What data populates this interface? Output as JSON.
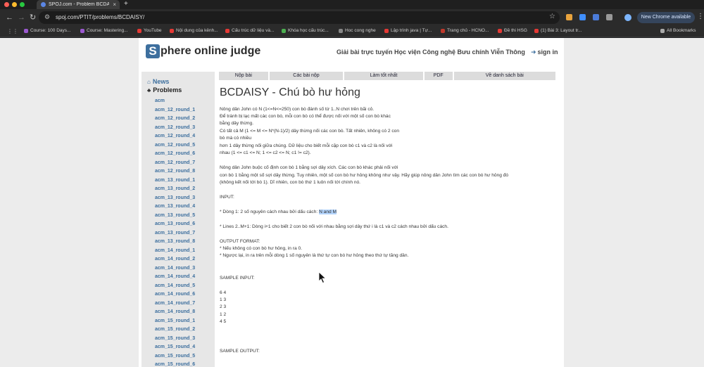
{
  "browser": {
    "tab_title": "SPOJ.com - Problem BCDAISY",
    "url": "spoj.com/PTIT/problems/BCDAISY/",
    "new_chrome_label": "New Chrome available",
    "bookmarks": [
      "Course: 100 Days...",
      "Course: Mastering...",
      "YouTube",
      "Nội dung của kênh...",
      "Cấu trúc dữ liệu và...",
      "Khóa học cấu trúc...",
      "Hoc cong nghe",
      "Lập trình java | Tự...",
      "Trang chủ - HCNO...",
      "Đề thi HSG",
      "(1) Bài 3: Layout tr..."
    ],
    "all_bookmarks": "All Bookmarks"
  },
  "site": {
    "logo_letter": "S",
    "logo_rest": "phere online judge",
    "tagline": "Giải bài trực tuyến Học viện Công nghệ Bưu chính Viễn Thông",
    "signin": "sign in"
  },
  "sidebar": {
    "news": "News",
    "problems": "Problems",
    "links": [
      "acm",
      "acm_12_round_1",
      "acm_12_round_2",
      "acm_12_round_3",
      "acm_12_round_4",
      "acm_12_round_5",
      "acm_12_round_6",
      "acm_12_round_7",
      "acm_12_round_8",
      "acm_13_round_1",
      "acm_13_round_2",
      "acm_13_round_3",
      "acm_13_round_4",
      "acm_13_round_5",
      "acm_13_round_6",
      "acm_13_round_7",
      "acm_13_round_8",
      "acm_14_round_1",
      "acm_14_round_2",
      "acm_14_round_3",
      "acm_14_round_4",
      "acm_14_round_5",
      "acm_14_round_6",
      "acm_14_round_7",
      "acm_14_round_8",
      "acm_15_round_1",
      "acm_15_round_2",
      "acm_15_round_3",
      "acm_15_round_4",
      "acm_15_round_5",
      "acm_15_round_6"
    ]
  },
  "problem_nav": [
    "Nộp bài",
    "Các bài nộp",
    "Làm tốt nhất",
    "PDF",
    "Về danh sách bài"
  ],
  "problem": {
    "title": "BCDAISY - Chú bò hư hỏng",
    "lines": [
      "Nông dân John có N (1<=N<=250) con bò đánh số từ 1..N chơi trên bãi cỏ.",
      "Để tránh bị lạc mất các con bò, mỗi con bò có thể được nối với một số con bò khác",
      "bằng dây thừng.",
      "Có tất cả M (1 <= M <= N*(N-1)/2) dây thừng nối các con bò. Tất nhiên, không có 2 con",
      "bò mà có nhiều",
      "hơn 1 dây thừng nối giữa chúng. Dữ liệu cho biết mỗi cặp con bò c1 và c2 là nối với",
      "nhau (1 <= c1 <= N; 1 <= c2 <= N; c1 != c2).",
      "Nông dân John buộc cố định con bò 1 bằng sợi dây xích. Các con bò khác phải nối với",
      "con bò 1 bằng một số sợi dây thừng. Tuy nhiên, một số con bò hư hỏng không như vậy. Hãy giúp nông dân John tìm các con bò hư hỏng đó",
      "(không kết nối tới bò 1). Dĩ nhiên, con bò thứ 1 luôn nối tới chính nó.",
      "INPUT:",
      "* Dòng 1: 2 số nguyên cách nhau bởi dấu cách: ",
      "* Lines 2..M+1: Dòng i+1 cho biết 2 con bò nối với nhau bằng sợi dây thứ i là c1 và c2 cách nhau bởi dấu cách.",
      "OUTPUT FORMAT:",
      "* Nếu không có con bò hư hỏng, in ra 0.",
      "* Ngược lại, in ra trên mỗi dòng 1 số nguyên là thứ tự con bò hư hỏng theo thứ tự tăng dần.",
      "SAMPLE INPUT:",
      "6 4",
      "1 3",
      "2 3",
      "1 2",
      "4 5",
      "SAMPLE OUTPUT:"
    ],
    "highlighted": "N and M"
  }
}
